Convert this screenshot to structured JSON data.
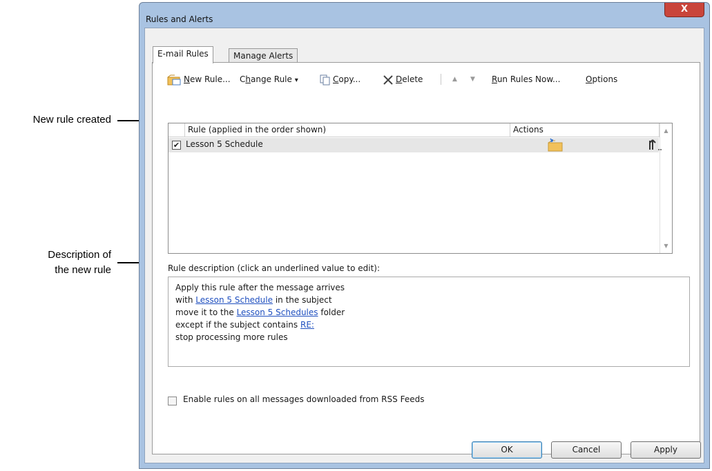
{
  "callouts": {
    "new_rule": "New rule created",
    "desc_line1": "Description of",
    "desc_line2": "the new rule"
  },
  "window": {
    "title": "Rules and Alerts",
    "close_glyph": "X"
  },
  "tabs": [
    {
      "label": "E-mail Rules",
      "active": true
    },
    {
      "label": "Manage Alerts",
      "active": false
    }
  ],
  "toolbar": {
    "new_rule": {
      "mnemonic": "N",
      "rest": "ew Rule..."
    },
    "change_rule": {
      "pre": "C",
      "mnemonic": "h",
      "rest": "ange Rule",
      "caret": "▾"
    },
    "copy": {
      "mnemonic": "C",
      "rest": "opy..."
    },
    "delete": {
      "mnemonic": "D",
      "rest": "elete"
    },
    "move_up": "▲",
    "move_down": "▼",
    "run_rules": {
      "mnemonic": "R",
      "rest": "un Rules Now..."
    },
    "options": {
      "mnemonic": "O",
      "rest": "ptions"
    }
  },
  "rules_table": {
    "columns": [
      "Rule (applied in the order shown)",
      "Actions"
    ],
    "rows": [
      {
        "checked": true,
        "check_glyph": "✔",
        "name": "Lesson 5 Schedule"
      }
    ],
    "scroll_up": "▲",
    "scroll_down": "▼"
  },
  "description": {
    "label": "Rule description (click an underlined value to edit):",
    "line1": "Apply this rule after the message arrives",
    "line2": {
      "pre": "with ",
      "link": "Lesson 5 Schedule",
      "post": " in the subject"
    },
    "line3": {
      "pre": "move it to the ",
      "link": "Lesson 5 Schedules",
      "post": " folder"
    },
    "line4": {
      "pre": "except if the subject contains ",
      "link": "RE:"
    },
    "line5": "stop processing more rules"
  },
  "rss": {
    "label": "Enable rules on all messages downloaded from RSS Feeds",
    "checked": false
  },
  "buttons": {
    "ok": "OK",
    "cancel": "Cancel",
    "apply": "Apply"
  },
  "colors": {
    "title_bar": "#a9c3e2",
    "close_button": "#c9453b",
    "link": "#1f4fbf",
    "selected_row": "#e6e6e6"
  }
}
